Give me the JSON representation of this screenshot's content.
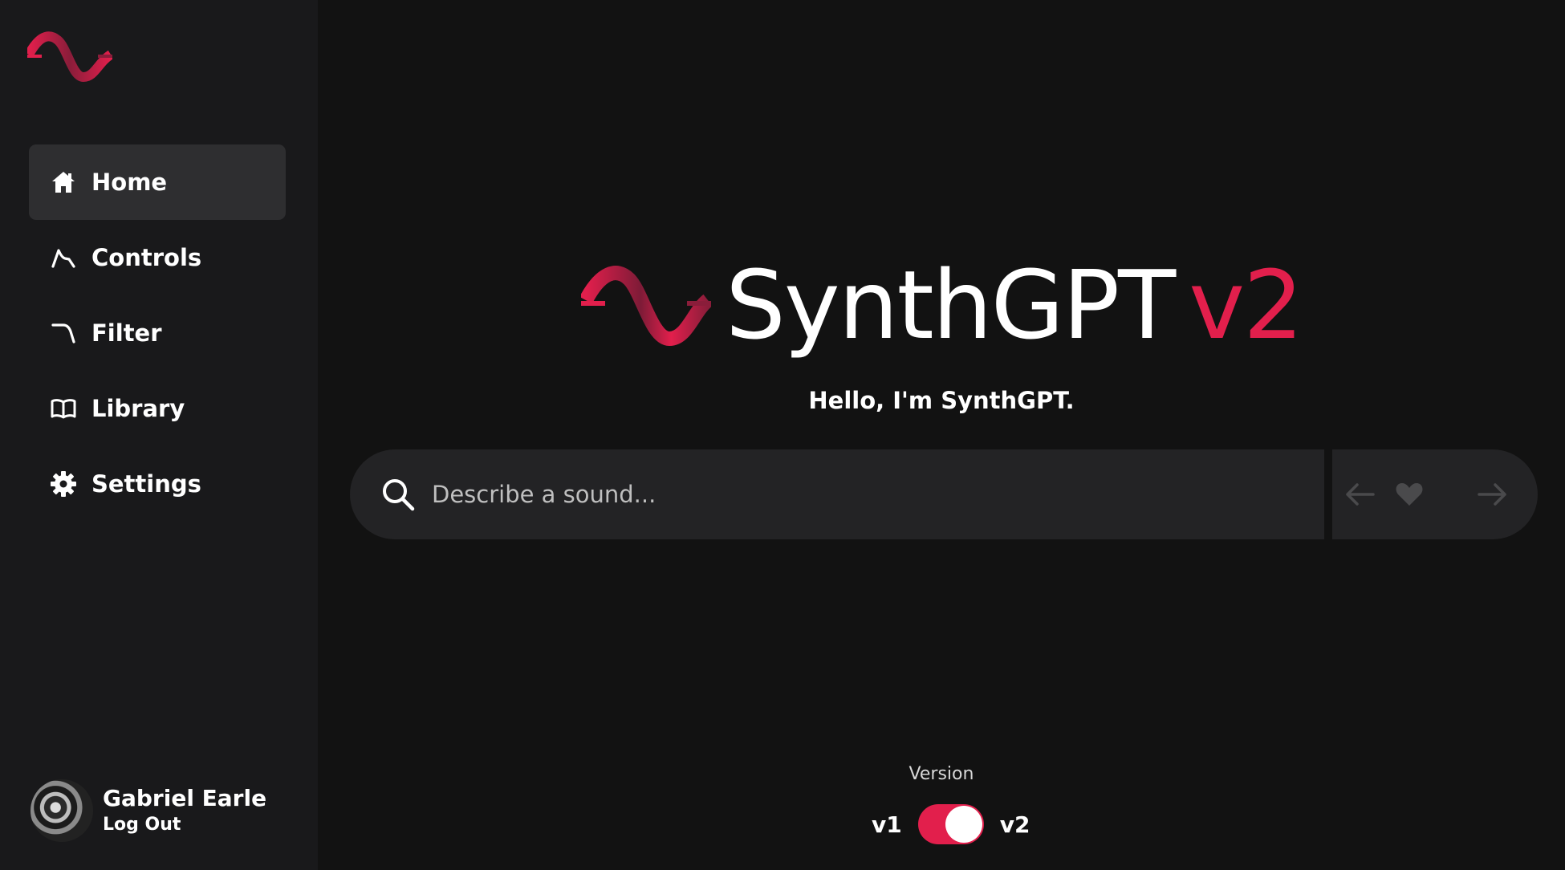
{
  "brand": {
    "name": "SynthGPT",
    "version_tag": "v2",
    "accent_color": "#e21f4c"
  },
  "sidebar": {
    "items": [
      {
        "label": "Home",
        "icon": "home-icon",
        "active": true
      },
      {
        "label": "Controls",
        "icon": "envelope-curve-icon",
        "active": false
      },
      {
        "label": "Filter",
        "icon": "filter-curve-icon",
        "active": false
      },
      {
        "label": "Library",
        "icon": "book-icon",
        "active": false
      },
      {
        "label": "Settings",
        "icon": "gear-icon",
        "active": false
      }
    ],
    "user": {
      "name": "Gabriel Earle",
      "logout_label": "Log Out"
    }
  },
  "main": {
    "greeting": "Hello, I'm SynthGPT.",
    "search": {
      "placeholder": "Describe a sound...",
      "value": ""
    },
    "controls": {
      "back_icon": "arrow-left-icon",
      "favorite_icon": "heart-icon",
      "forward_icon": "arrow-right-icon"
    },
    "version": {
      "label": "Version",
      "left_option": "v1",
      "right_option": "v2",
      "selected": "v2"
    }
  }
}
